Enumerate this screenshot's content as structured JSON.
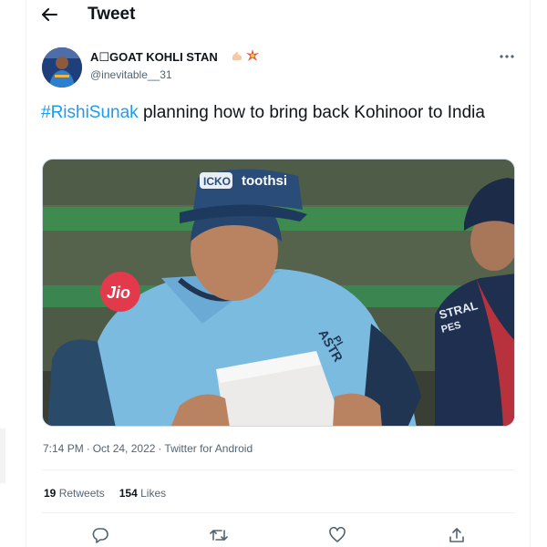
{
  "header": {
    "title": "Tweet",
    "back_icon": "arrow-left-icon"
  },
  "author": {
    "display_name": "A☐GOAT KOHLI STAN",
    "emoji": [
      "flexed-biceps-icon",
      "sparkle-icon"
    ],
    "handle": "@inevitable__31"
  },
  "tweet": {
    "hashtag": "#RishiSunak",
    "text": " planning how to bring back Kohinoor to India",
    "media_subject": "photo",
    "media_texts": {
      "cap_badge": "ICKO",
      "cap_brand": "toothsi",
      "sleeve_logo": "Jio",
      "chest_logo": "ASTR",
      "chest_logo_2": "PI",
      "neighbor_shirt": "STRAL",
      "neighbor_shirt_2": "PES"
    }
  },
  "meta": {
    "time": "7:14 PM",
    "separator": "·",
    "date": "Oct 24, 2022",
    "source": "Twitter for Android"
  },
  "stats": {
    "retweets_count": "19",
    "retweets_label": "Retweets",
    "likes_count": "154",
    "likes_label": "Likes"
  },
  "actions": [
    "reply-icon",
    "retweet-icon",
    "like-icon",
    "share-icon"
  ],
  "colors": {
    "accent": "#1d9bf0",
    "text": "#0f1419",
    "secondary": "#536471",
    "divider": "#eff3f4"
  }
}
